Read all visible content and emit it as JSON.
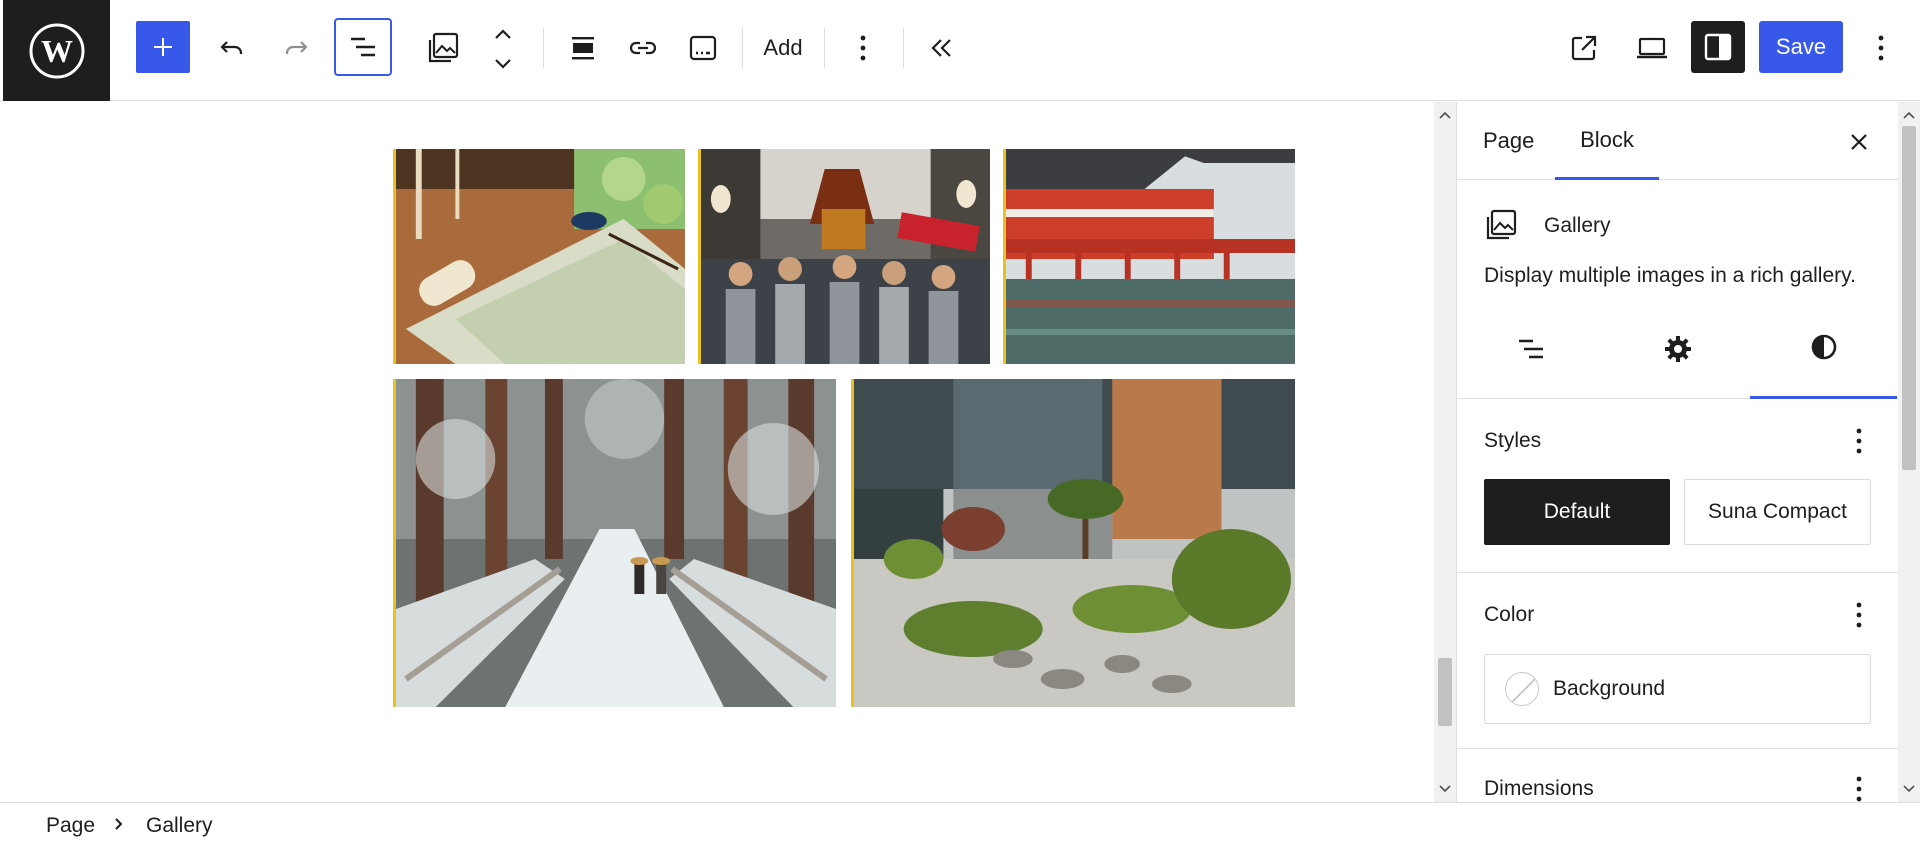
{
  "toolbar": {
    "add_label": "Add",
    "save_label": "Save"
  },
  "gallery": {
    "images": [
      {
        "name": "scroll-and-ink-image"
      },
      {
        "name": "festival-procession-image"
      },
      {
        "name": "red-shrine-pier-image"
      },
      {
        "name": "snowy-forest-path-image"
      },
      {
        "name": "zen-garden-house-image"
      }
    ]
  },
  "sidebar": {
    "tabs": [
      "Page",
      "Block"
    ],
    "active_tab": "Block",
    "block": {
      "title": "Gallery",
      "description": "Display multiple images in a rich gallery."
    },
    "styles": {
      "title": "Styles",
      "options": [
        "Default",
        "Suna Compact"
      ],
      "selected": "Default"
    },
    "color": {
      "title": "Color",
      "background_label": "Background"
    },
    "dimensions": {
      "title": "Dimensions"
    }
  },
  "breadcrumb": [
    "Page",
    "Gallery"
  ],
  "colors": {
    "accent": "#3858e9",
    "dark": "#1e1e1e",
    "gallery_border": "#e8c31c"
  }
}
